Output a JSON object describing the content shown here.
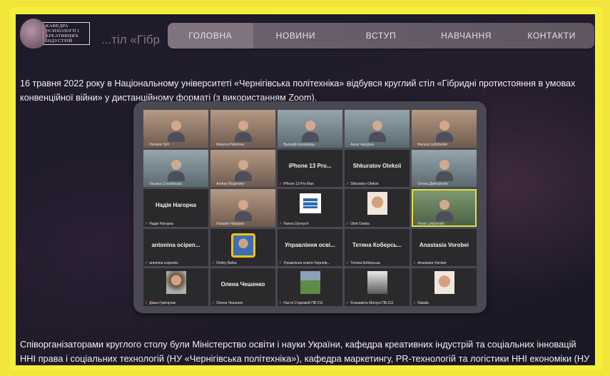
{
  "nav": {
    "items": [
      "ГОЛОВНА",
      "НОВИНИ",
      "ВСТУП",
      "НАВЧАННЯ",
      "КОНТАКТИ"
    ]
  },
  "logo": {
    "text": "КАФЕДРА ПСИХОЛОГІЇ І КРЕАТИВНИХ ІНДУСТРІЙ"
  },
  "header_fragment": "...тіл «Гібр",
  "paragraph1": "16 травня 2022 року в Національному університеті «Чернігівська політехніка» відбувся круглий стіл «Гібридні протистояння в умовах конвенційної війни» у дистанційному форматі (з використанням Zoom).",
  "paragraph2": "Співорганізаторами круглого столу були Міністерство освіти і науки України, кафедра креативних індустрій та соціальних інновацій ННІ права і соціальних технологій (НУ «Чернігівська політехніка»), кафедра маркетингу, PR-технологій та логістики ННІ економіки (НУ «Чернігівська політехніка») та Фонд «IT-Паросток».",
  "zoom": {
    "tiles": [
      {
        "name": "Наталія Зуб",
        "kind": "video",
        "tone": "warm"
      },
      {
        "name": "Maryna Polenova",
        "kind": "video",
        "tone": "warm"
      },
      {
        "name": "Валерій Коломієць",
        "kind": "video",
        "tone": "cool"
      },
      {
        "name": "Анна Чапурна",
        "kind": "video",
        "tone": "cool"
      },
      {
        "name": "Maryna Lyttchenko",
        "kind": "video",
        "tone": "warm"
      },
      {
        "name": "Оксана Сосновська",
        "kind": "video",
        "tone": "cool"
      },
      {
        "name": "Andrey Rogovsky",
        "kind": "video",
        "tone": "warm"
      },
      {
        "name": "iPhone 13 Pro Max",
        "kind": "text",
        "label": "iPhone 13 Pro..."
      },
      {
        "name": "Shkuratov Oleksii",
        "kind": "text",
        "label": "Shkuratov Oleksii"
      },
      {
        "name": "Олена Дмитрієнко",
        "kind": "video",
        "tone": "cool"
      },
      {
        "name": "Надія Нагорна",
        "kind": "text",
        "label": "Надія Нагорна"
      },
      {
        "name": "Наталія Чапурна",
        "kind": "video",
        "tone": "warm"
      },
      {
        "name": "Hanna Dyvnych",
        "kind": "logo"
      },
      {
        "name": "Oleh Doeba",
        "kind": "photo",
        "style": "face"
      },
      {
        "name": "Pavlo Lyttchenko",
        "kind": "video",
        "tone": "green",
        "highlight": true
      },
      {
        "name": "antonina ocipenko",
        "kind": "text",
        "label": "antonina ocipen..."
      },
      {
        "name": "Dmitry Belka",
        "kind": "avatar"
      },
      {
        "name": "Управління освіти Чернігів...",
        "kind": "text",
        "label": "Управління осві..."
      },
      {
        "name": "Тетяна Коберська",
        "kind": "text",
        "label": "Тетяна Коберсь..."
      },
      {
        "name": "Anastasia Vorobei",
        "kind": "text",
        "label": "Anastasia Vorobei"
      },
      {
        "name": "Діана Григорчак",
        "kind": "photo",
        "style": "girl"
      },
      {
        "name": "Олена Чешенко",
        "kind": "text",
        "label": "Олена Чешенко"
      },
      {
        "name": "Настя Старовой ПВ-211",
        "kind": "photo",
        "style": "field"
      },
      {
        "name": "Єлизавета Мачуга ПВ-211",
        "kind": "photo",
        "style": "bw"
      },
      {
        "name": "Natalia",
        "kind": "photo",
        "style": "face"
      }
    ]
  }
}
